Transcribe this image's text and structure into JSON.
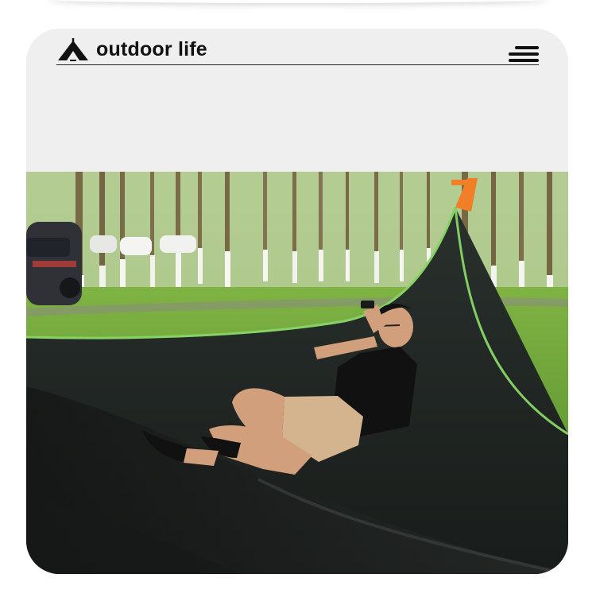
{
  "brand": {
    "title": "outdoor life",
    "logo_icon": "tent-icon"
  },
  "menu": {
    "icon": "menu-icon"
  },
  "photo": {
    "subject": "hammock-photo"
  },
  "colors": {
    "card_background": "#efefef",
    "text": "#111111",
    "grass": "#5f9a32",
    "hammock": "#1f2421",
    "hammock_edge": "#7fd05c"
  }
}
